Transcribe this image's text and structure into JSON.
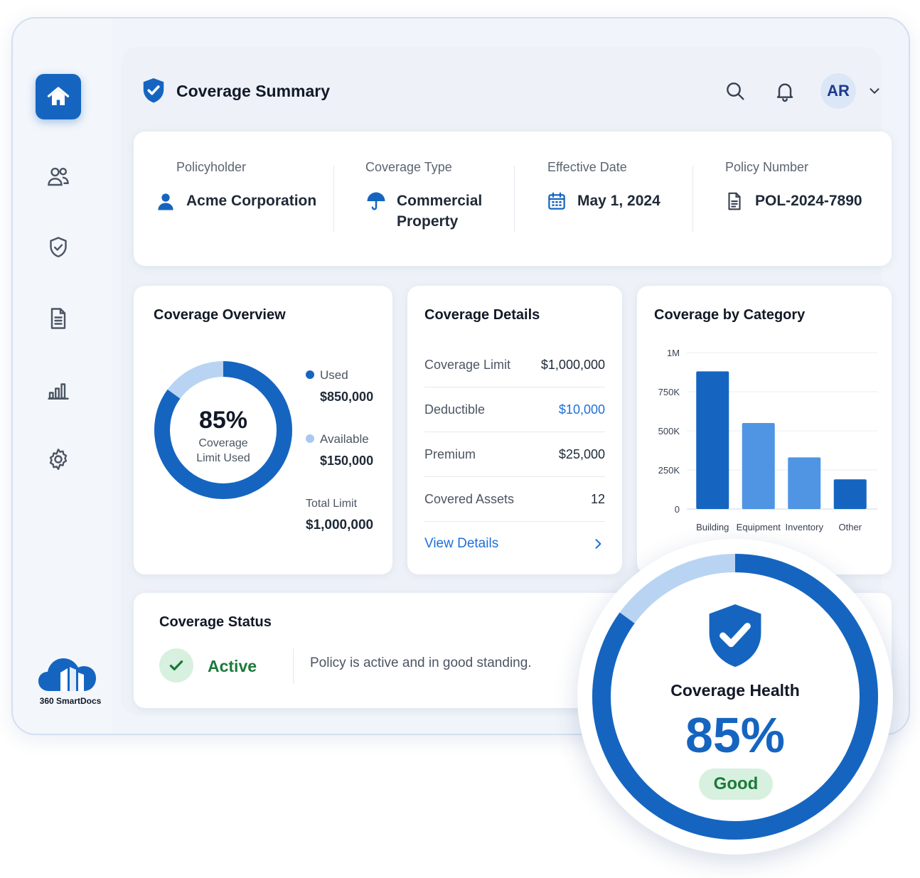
{
  "header": {
    "title": "Coverage Summary",
    "avatar_initials": "AR"
  },
  "sidebar": {
    "items": [
      {
        "name": "home",
        "icon": "home-icon",
        "active": true
      },
      {
        "name": "users",
        "icon": "users-icon",
        "active": false
      },
      {
        "name": "shield",
        "icon": "shield-check-icon",
        "active": false
      },
      {
        "name": "documents",
        "icon": "document-icon",
        "active": false
      },
      {
        "name": "analytics",
        "icon": "bar-chart-icon",
        "active": false
      },
      {
        "name": "settings",
        "icon": "gear-icon",
        "active": false
      }
    ],
    "brand": "360 SmartDocs"
  },
  "summary": {
    "policyholder": {
      "label": "Policyholder",
      "value": "Acme Corporation"
    },
    "coverage_type": {
      "label": "Coverage Type",
      "value_line1": "Commercial",
      "value_line2": "Property"
    },
    "effective_date": {
      "label": "Effective Date",
      "value": "May 1, 2024"
    },
    "policy_number": {
      "label": "Policy Number",
      "value": "POL-2024-7890"
    }
  },
  "overview": {
    "title": "Coverage Overview",
    "percent_label": "85%",
    "center_caption_line1": "Coverage",
    "center_caption_line2": "Limit Used",
    "used_fraction": 0.85,
    "used_label": "Used",
    "used_value": "$850,000",
    "available_label": "Available",
    "available_value": "$150,000",
    "total_label": "Total Limit",
    "total_value": "$1,000,000"
  },
  "details": {
    "title": "Coverage Details",
    "rows": [
      {
        "label": "Coverage Limit",
        "value": "$1,000,000"
      },
      {
        "label": "Deductible",
        "value": "$10,000"
      },
      {
        "label": "Premium",
        "value": "$25,000"
      },
      {
        "label": "Covered Assets",
        "value": "12"
      }
    ],
    "link": "View Details"
  },
  "category": {
    "title": "Coverage by Category"
  },
  "chart_data": {
    "type": "bar",
    "title": "Coverage by Category",
    "categories": [
      "Building",
      "Equipment",
      "Inventory",
      "Other"
    ],
    "values": [
      880000,
      550000,
      330000,
      190000
    ],
    "ylim": [
      0,
      1000000
    ],
    "yticks": [
      "0",
      "250K",
      "500K",
      "750K",
      "1M"
    ],
    "colors": [
      "#1565c0",
      "#4f95e3",
      "#4f95e3",
      "#1565c0"
    ],
    "grid": true
  },
  "status": {
    "title": "Coverage Status",
    "state": "Active",
    "message": "Policy is active and in good standing."
  },
  "health": {
    "title": "Coverage Health",
    "value": "85%",
    "fraction": 0.85,
    "badge": "Good"
  },
  "colors": {
    "primary": "#1565c0",
    "light": "#b9d4f3",
    "success": "#1b7a3a",
    "success_bg": "#d8f0df"
  }
}
